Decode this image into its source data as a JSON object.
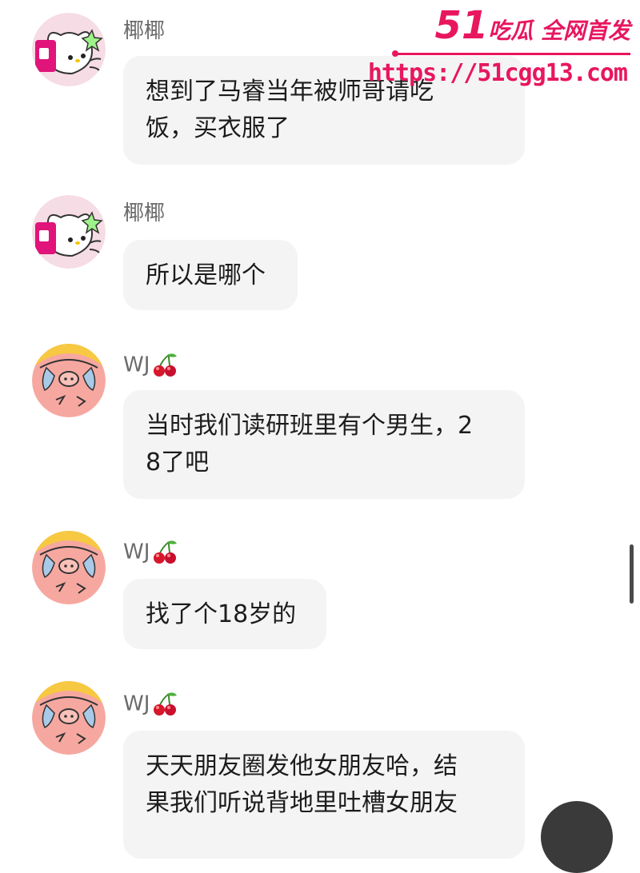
{
  "messages": [
    {
      "sender": "椰椰",
      "avatar": "hello-kitty-avatar",
      "lines": [
        "想到了马睿当年被师哥请吃",
        "饭，买衣服了"
      ],
      "emoji": ""
    },
    {
      "sender": "椰椰",
      "avatar": "hello-kitty-avatar",
      "lines": [
        "所以是哪个"
      ],
      "emoji": ""
    },
    {
      "sender": "WJ",
      "avatar": "pig-avatar",
      "lines": [
        "当时我们读研班里有个男生，2",
        "8了吧"
      ],
      "emoji": "cherry"
    },
    {
      "sender": "WJ",
      "avatar": "pig-avatar",
      "lines": [
        "找了个18岁的"
      ],
      "emoji": "cherry"
    },
    {
      "sender": "WJ",
      "avatar": "pig-avatar",
      "lines": [
        "天天朋友圈发他女朋友哈，结",
        "果我们听说背地里吐槽女朋友"
      ],
      "emoji": "cherry"
    }
  ],
  "watermark": {
    "brand_num": "51",
    "brand_text": "吃瓜 全网首发",
    "url": "https://51cgg13.com",
    "color": "#e8165f"
  },
  "colors": {
    "bubble_bg": "#f4f4f4",
    "sender_text": "#6b6b6b",
    "message_text": "#1c1c1c"
  }
}
